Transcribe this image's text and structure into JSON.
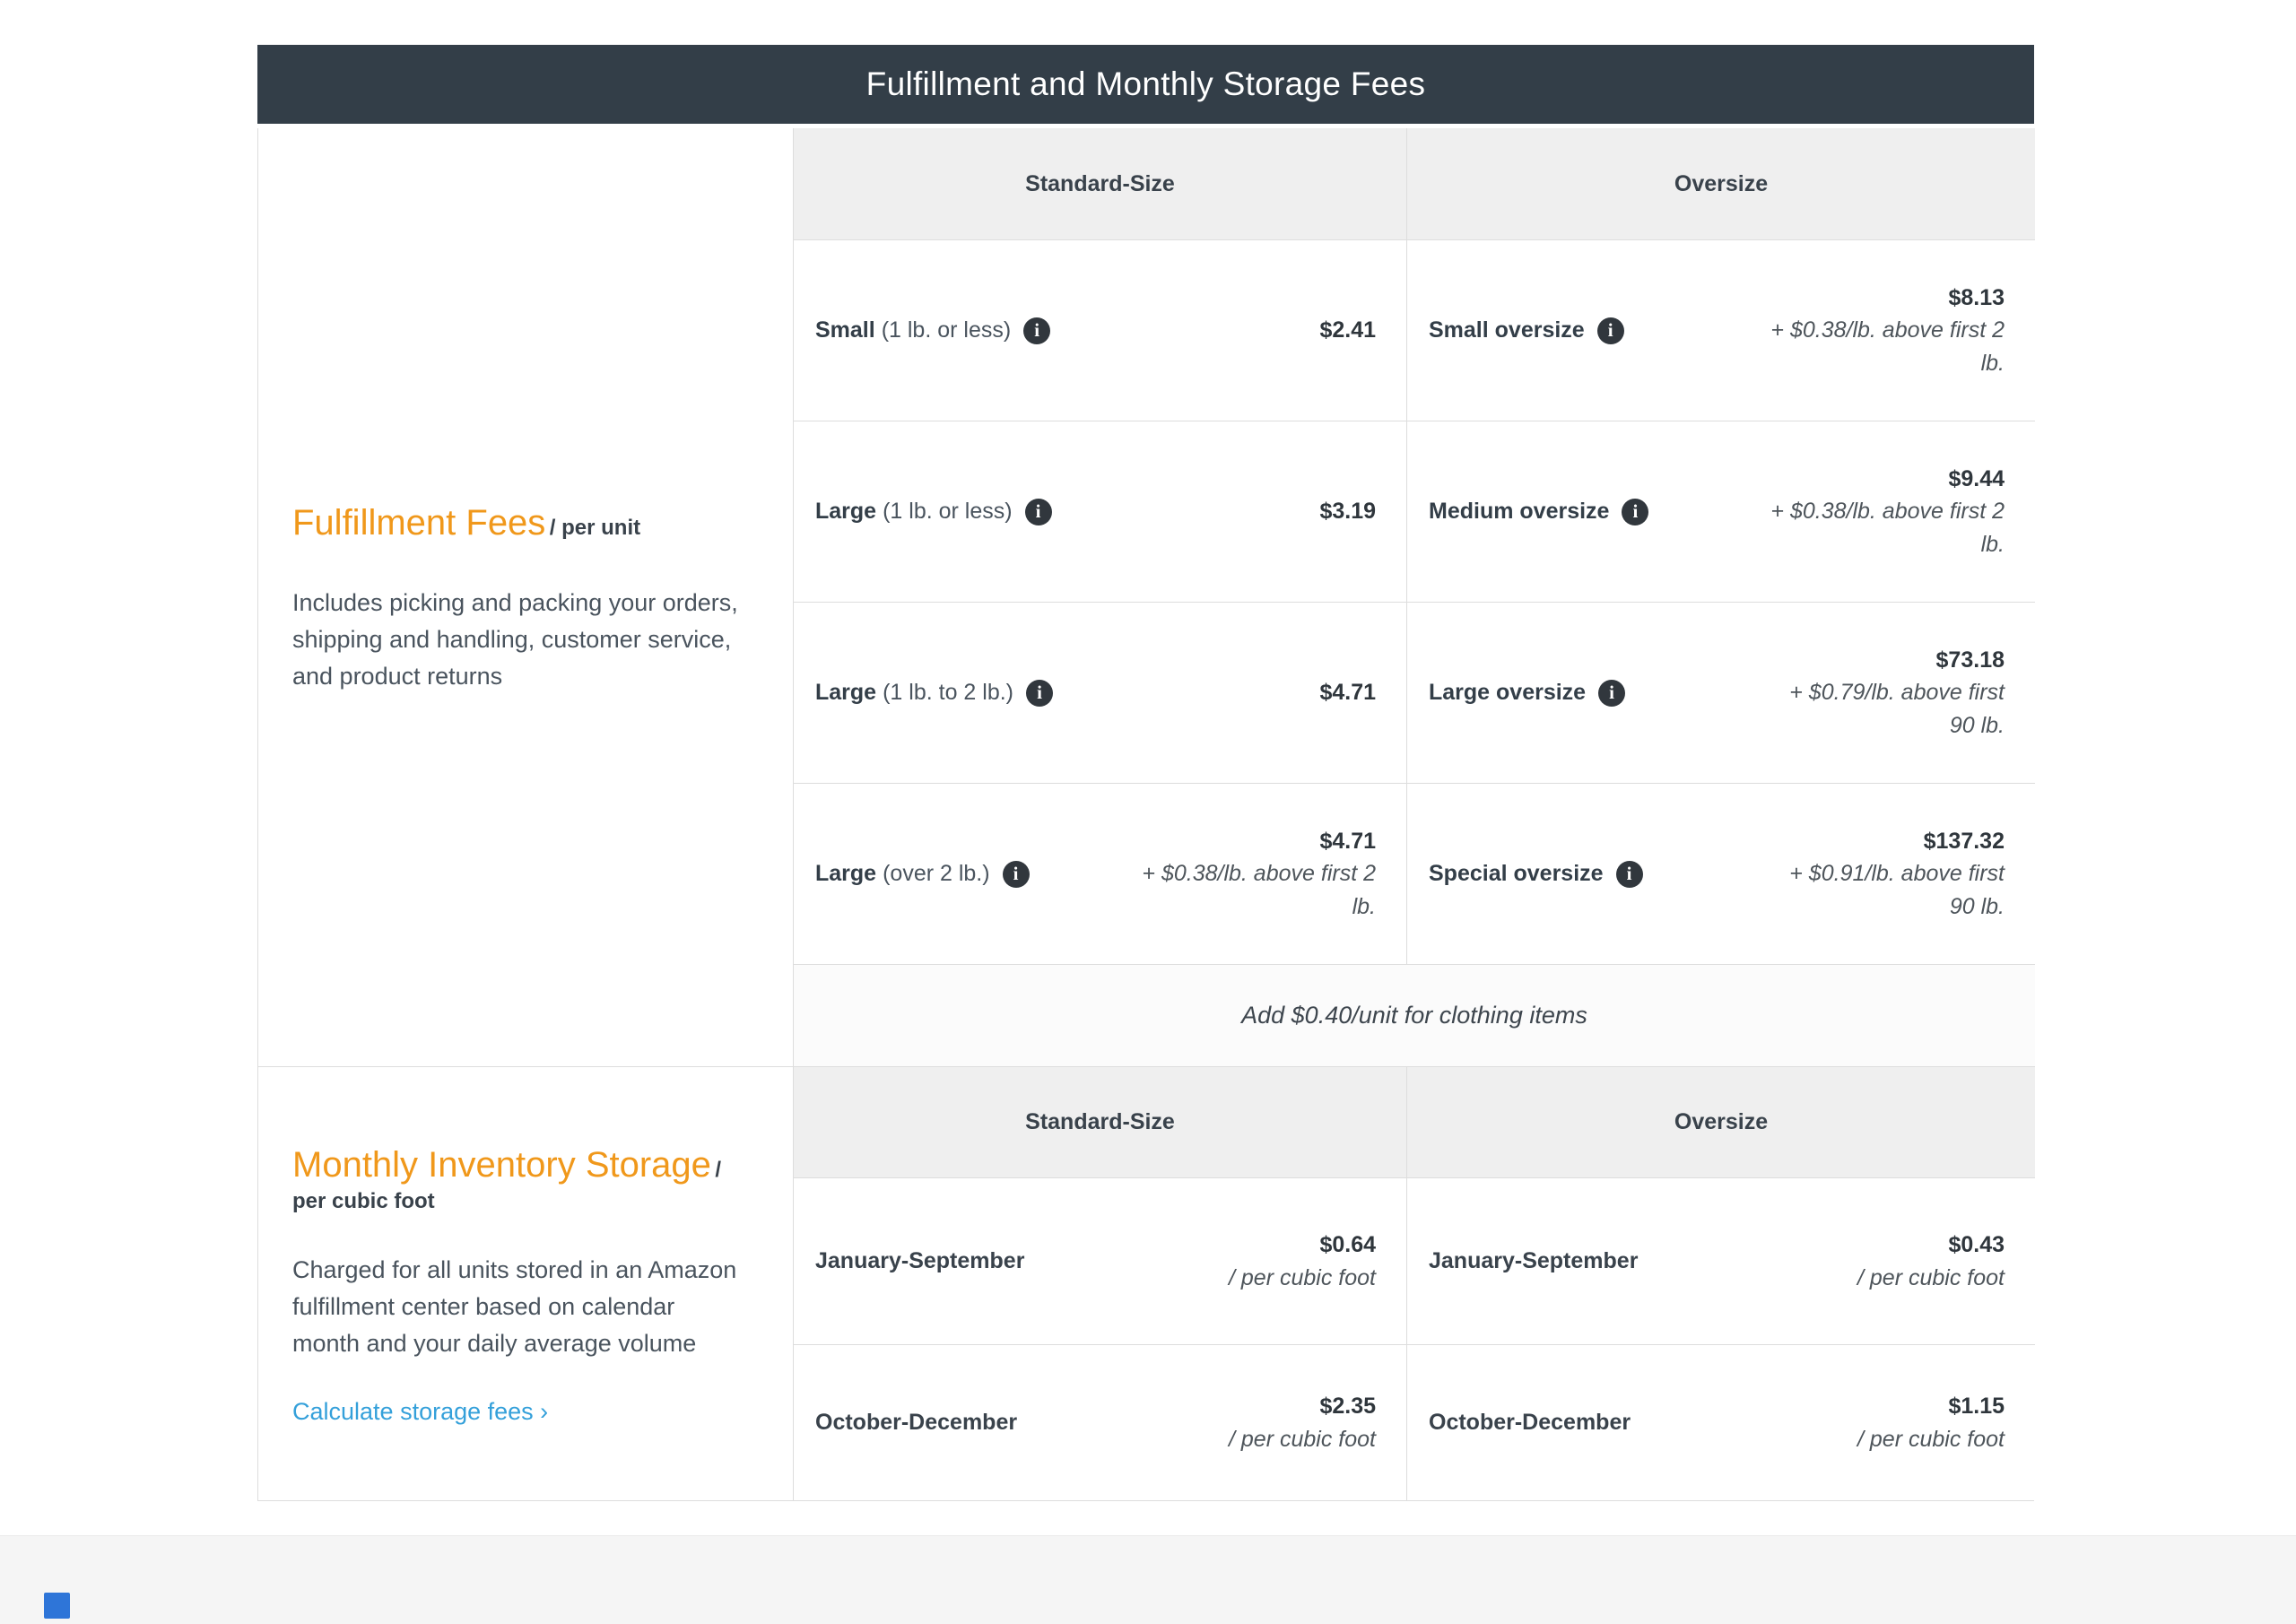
{
  "page": {
    "title": "Fulfillment and Monthly Storage Fees"
  },
  "columns": {
    "standard": "Standard-Size",
    "oversize": "Oversize"
  },
  "fulfillment": {
    "heading": "Fulfillment Fees",
    "unit": "/ per unit",
    "description": "Includes picking and packing your orders, shipping and handling, customer service, and product returns",
    "rows": [
      {
        "std_name": "Small",
        "std_size": "(1 lb. or less)",
        "std_price": "$2.41",
        "std_note": "",
        "ov_name": "Small oversize",
        "ov_price": "$8.13",
        "ov_note": "+ $0.38/lb. above first 2\nlb."
      },
      {
        "std_name": "Large",
        "std_size": "(1 lb. or less)",
        "std_price": "$3.19",
        "std_note": "",
        "ov_name": "Medium oversize",
        "ov_price": "$9.44",
        "ov_note": "+ $0.38/lb. above first 2\nlb."
      },
      {
        "std_name": "Large",
        "std_size": "(1 lb. to 2 lb.)",
        "std_price": "$4.71",
        "std_note": "",
        "ov_name": "Large oversize",
        "ov_price": "$73.18",
        "ov_note": "+ $0.79/lb. above first\n90 lb."
      },
      {
        "std_name": "Large",
        "std_size": "(over 2 lb.)",
        "std_price": "$4.71",
        "std_note": "+ $0.38/lb. above first 2\nlb.",
        "ov_name": "Special oversize",
        "ov_price": "$137.32",
        "ov_note": "+ $0.91/lb. above first\n90 lb."
      }
    ],
    "clothing_note": "Add $0.40/unit for clothing items"
  },
  "storage": {
    "heading": "Monthly Inventory Storage",
    "unit": "/ per cubic foot",
    "description": "Charged for all units stored in an Amazon fulfillment center based on calendar month and your daily average volume",
    "link": "Calculate storage fees ›",
    "rows": [
      {
        "label": "January-September",
        "std_price": "$0.64",
        "std_unit": "/ per cubic foot",
        "ov_price": "$0.43",
        "ov_unit": "/ per cubic foot"
      },
      {
        "label": "October-December",
        "std_price": "$2.35",
        "std_unit": "/ per cubic foot",
        "ov_price": "$1.15",
        "ov_unit": "/ per cubic foot"
      }
    ]
  },
  "icons": {
    "info": "i"
  },
  "colors": {
    "header_bg": "#333E48",
    "accent_orange": "#F0981B",
    "link_blue": "#34A0DA",
    "header_cell_bg": "#EFEFEF",
    "border": "#DDDDDD",
    "footer_bg": "#F5F5F5",
    "widget_blue": "#2E75D8"
  }
}
